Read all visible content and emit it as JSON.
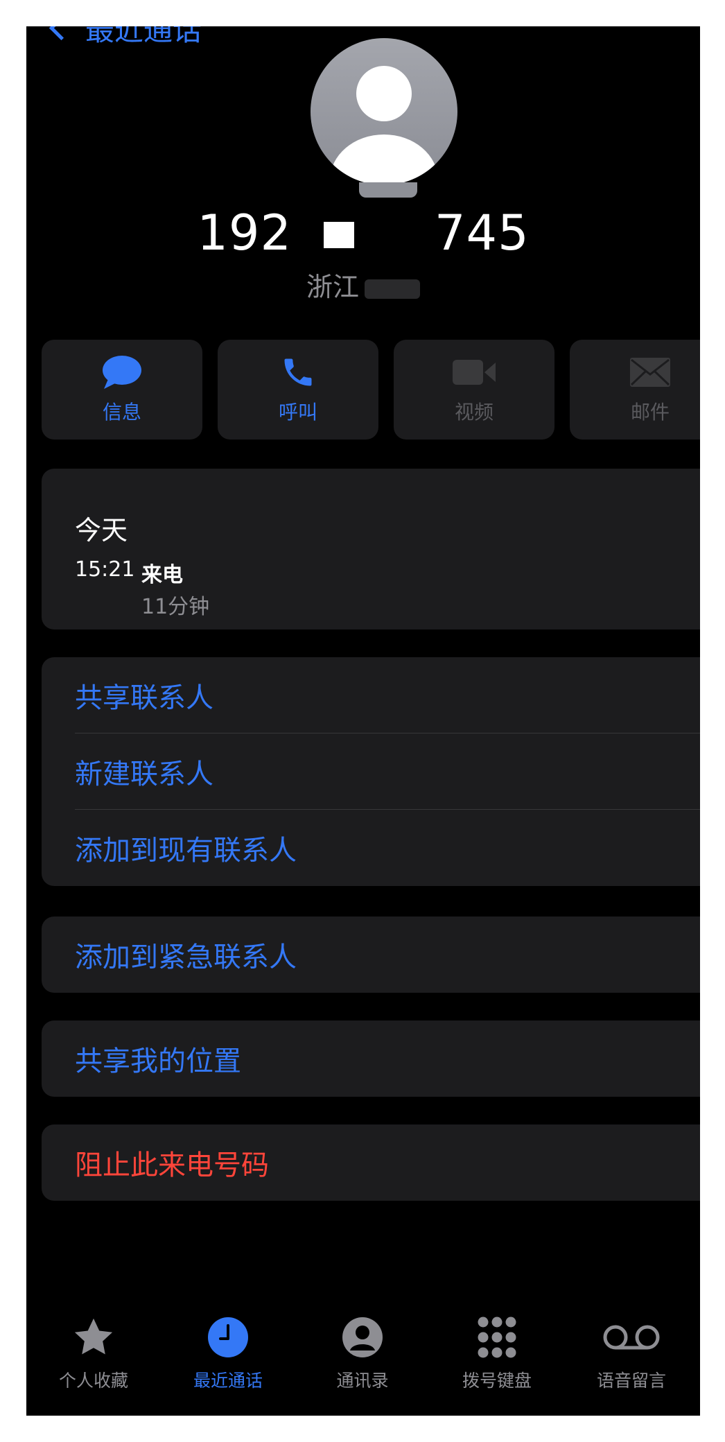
{
  "nav": {
    "back_label": "最近通话"
  },
  "contact": {
    "number_prefix": "192",
    "number_suffix": "745",
    "location": "浙江"
  },
  "actions": [
    {
      "label": "信息",
      "icon": "message-bubble-icon",
      "enabled": true
    },
    {
      "label": "呼叫",
      "icon": "phone-icon",
      "enabled": true
    },
    {
      "label": "视频",
      "icon": "video-camera-icon",
      "enabled": false
    },
    {
      "label": "邮件",
      "icon": "envelope-icon",
      "enabled": false
    }
  ],
  "recent": {
    "day": "今天",
    "time": "15:21",
    "type": "来电",
    "duration": "11分钟"
  },
  "options": {
    "share_contact": "共享联系人",
    "new_contact": "新建联系人",
    "add_existing": "添加到现有联系人",
    "add_emergency": "添加到紧急联系人",
    "share_location": "共享我的位置",
    "block": "阻止此来电号码"
  },
  "tabs": [
    {
      "label": "个人收藏",
      "icon": "star-icon",
      "active": false
    },
    {
      "label": "最近通话",
      "icon": "clock-icon",
      "active": true
    },
    {
      "label": "通讯录",
      "icon": "person-circle-icon",
      "active": false
    },
    {
      "label": "拨号键盘",
      "icon": "keypad-icon",
      "active": false
    },
    {
      "label": "语音留言",
      "icon": "voicemail-icon",
      "active": false
    }
  ],
  "colors": {
    "accent": "#3478f6",
    "danger": "#ff453a",
    "card": "#1c1c1e",
    "background": "#000000"
  }
}
